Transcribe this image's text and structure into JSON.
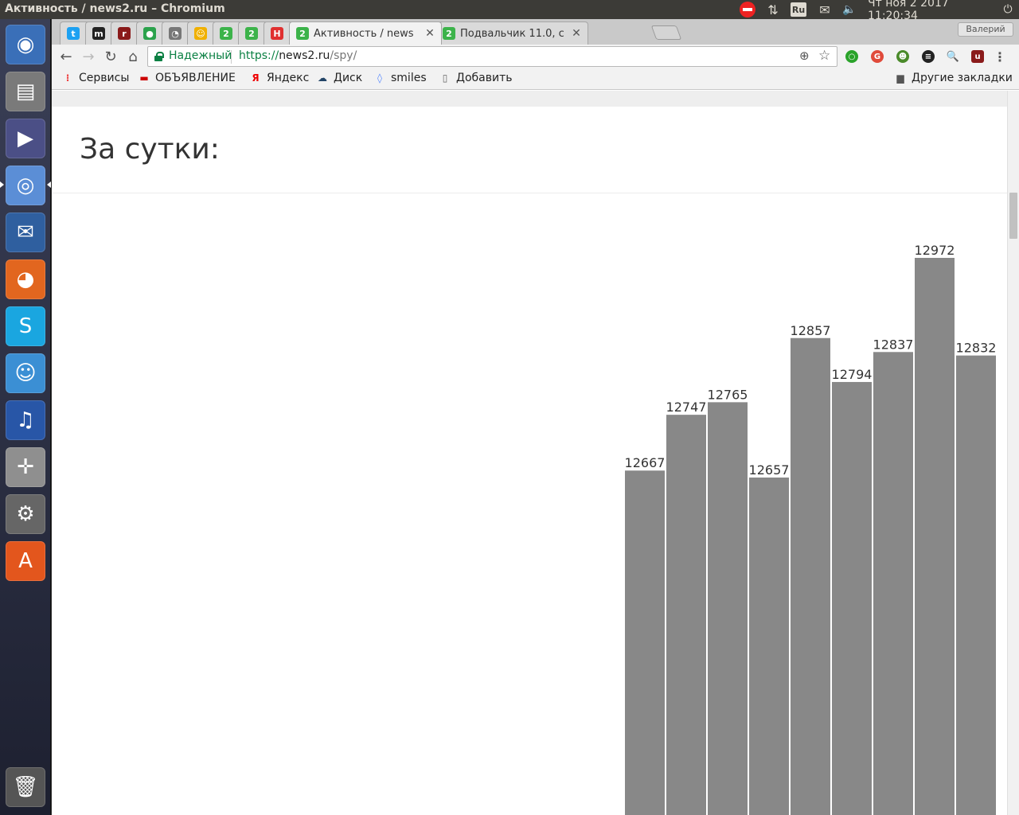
{
  "window": {
    "title": "Активность / news2.ru – Chromium"
  },
  "top_panel": {
    "lang": "Ru",
    "clock": "Чт ноя  2 2017 11:20:34"
  },
  "launcher": {
    "items": [
      {
        "name": "ubuntu-dash-icon",
        "color": "#3a6fb8"
      },
      {
        "name": "files-icon",
        "color": "#7a7a7a"
      },
      {
        "name": "presentation-app-icon",
        "color": "#4b4f86"
      },
      {
        "name": "chromium-icon",
        "color": "#5b8ed6"
      },
      {
        "name": "thunderbird-icon",
        "color": "#2f5f9f"
      },
      {
        "name": "firefox-icon",
        "color": "#e2661f"
      },
      {
        "name": "skype-icon",
        "color": "#1aa6e0"
      },
      {
        "name": "messenger-icon",
        "color": "#3b8fd4"
      },
      {
        "name": "audacity-icon",
        "color": "#2856a7"
      },
      {
        "name": "screenshot-tool-icon",
        "color": "#8f8f8f"
      },
      {
        "name": "system-settings-icon",
        "color": "#666666"
      },
      {
        "name": "software-center-icon",
        "color": "#e3561d"
      }
    ],
    "trash": {
      "name": "trash-icon",
      "color": "#555"
    }
  },
  "tabs": [
    {
      "label": "",
      "fav_color": "#1da1f2",
      "fav_text": "t"
    },
    {
      "label": "",
      "fav_color": "#222222",
      "fav_text": "m"
    },
    {
      "label": "",
      "fav_color": "#8a1a1a",
      "fav_text": "r"
    },
    {
      "label": "",
      "fav_color": "#2ba24c",
      "fav_text": "●"
    },
    {
      "label": "",
      "fav_color": "#777777",
      "fav_text": "◔"
    },
    {
      "label": "",
      "fav_color": "#f0b000",
      "fav_text": "☺"
    },
    {
      "label": "",
      "fav_color": "#3cb34a",
      "fav_text": "2"
    },
    {
      "label": "",
      "fav_color": "#3cb34a",
      "fav_text": "2"
    },
    {
      "label": "",
      "fav_color": "#e03030",
      "fav_text": "H"
    },
    {
      "label": "Активность / news",
      "fav_color": "#3cb34a",
      "fav_text": "2"
    },
    {
      "label": "Подвальчик 11.0, с",
      "fav_color": "#3cb34a",
      "fav_text": "2"
    }
  ],
  "profile": {
    "name": "Валерий"
  },
  "omnibox": {
    "secure_label": "Надежный",
    "url_scheme": "https://",
    "url_host": "news2.ru",
    "url_path": "/spy/"
  },
  "bookmarks": [
    {
      "label": "Сервисы",
      "icon": "apps-icon",
      "color": "#e44"
    },
    {
      "label": "ОБЪЯВЛЕНИЕ",
      "icon": "flag-icon",
      "color": "#c00"
    },
    {
      "label": "Яндекс",
      "icon": "yandex-icon",
      "color": "#e00"
    },
    {
      "label": "Диск",
      "icon": "disk-icon",
      "color": "#246"
    },
    {
      "label": "smiles",
      "icon": "smiles-icon",
      "color": "#58f"
    },
    {
      "label": "Добавить",
      "icon": "page-icon",
      "color": "#666"
    }
  ],
  "other_bookmarks": "Другие закладки",
  "page": {
    "section_title": "За сутки:"
  },
  "chart_data": {
    "type": "bar",
    "bar_color": "#888888",
    "values": [
      12667,
      12747,
      12765,
      12657,
      12857,
      12794,
      12837,
      12972,
      12832
    ],
    "data_labels": [
      "12667",
      "12747",
      "12765",
      "12657",
      "12857",
      "12794",
      "12837",
      "12972",
      "12832"
    ]
  }
}
